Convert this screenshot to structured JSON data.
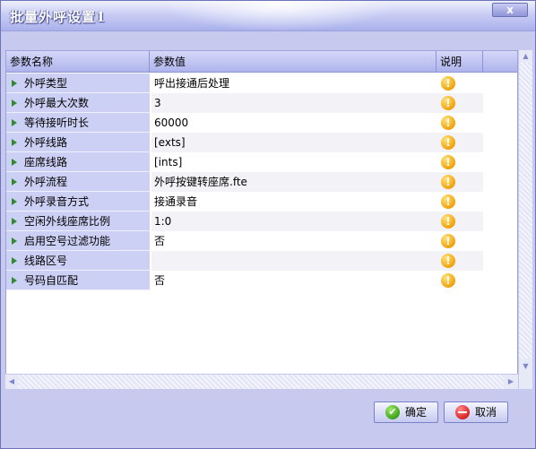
{
  "window": {
    "title": "批量外呼设置1",
    "close_glyph": "x"
  },
  "grid": {
    "columns": [
      "参数名称",
      "参数值",
      "说明"
    ],
    "rows": [
      {
        "name": "外呼类型",
        "value": "呼出接通后处理",
        "note_icon": "warning-icon"
      },
      {
        "name": "外呼最大次数",
        "value": "3",
        "note_icon": "warning-icon"
      },
      {
        "name": "等待接听时长",
        "value": "60000",
        "note_icon": "warning-icon"
      },
      {
        "name": "外呼线路",
        "value": "[exts]",
        "note_icon": "warning-icon"
      },
      {
        "name": "座席线路",
        "value": "[ints]",
        "note_icon": "warning-icon"
      },
      {
        "name": "外呼流程",
        "value": "外呼按键转座席.fte",
        "note_icon": "warning-icon"
      },
      {
        "name": "外呼录音方式",
        "value": "接通录音",
        "note_icon": "warning-icon"
      },
      {
        "name": "空闲外线座席比例",
        "value": "1:0",
        "note_icon": "warning-icon"
      },
      {
        "name": "启用空号过滤功能",
        "value": "否",
        "note_icon": "warning-icon"
      },
      {
        "name": "线路区号",
        "value": "",
        "note_icon": "warning-icon"
      },
      {
        "name": "号码自匹配",
        "value": "否",
        "note_icon": "warning-icon"
      }
    ]
  },
  "buttons": {
    "ok_label": "确定",
    "cancel_label": "取消"
  },
  "colors": {
    "accent": "#aab1ec",
    "name_cell_bg": "#cdd0f5",
    "warning": "#f2a20a",
    "ok": "#3ba319",
    "cancel": "#d92222"
  }
}
